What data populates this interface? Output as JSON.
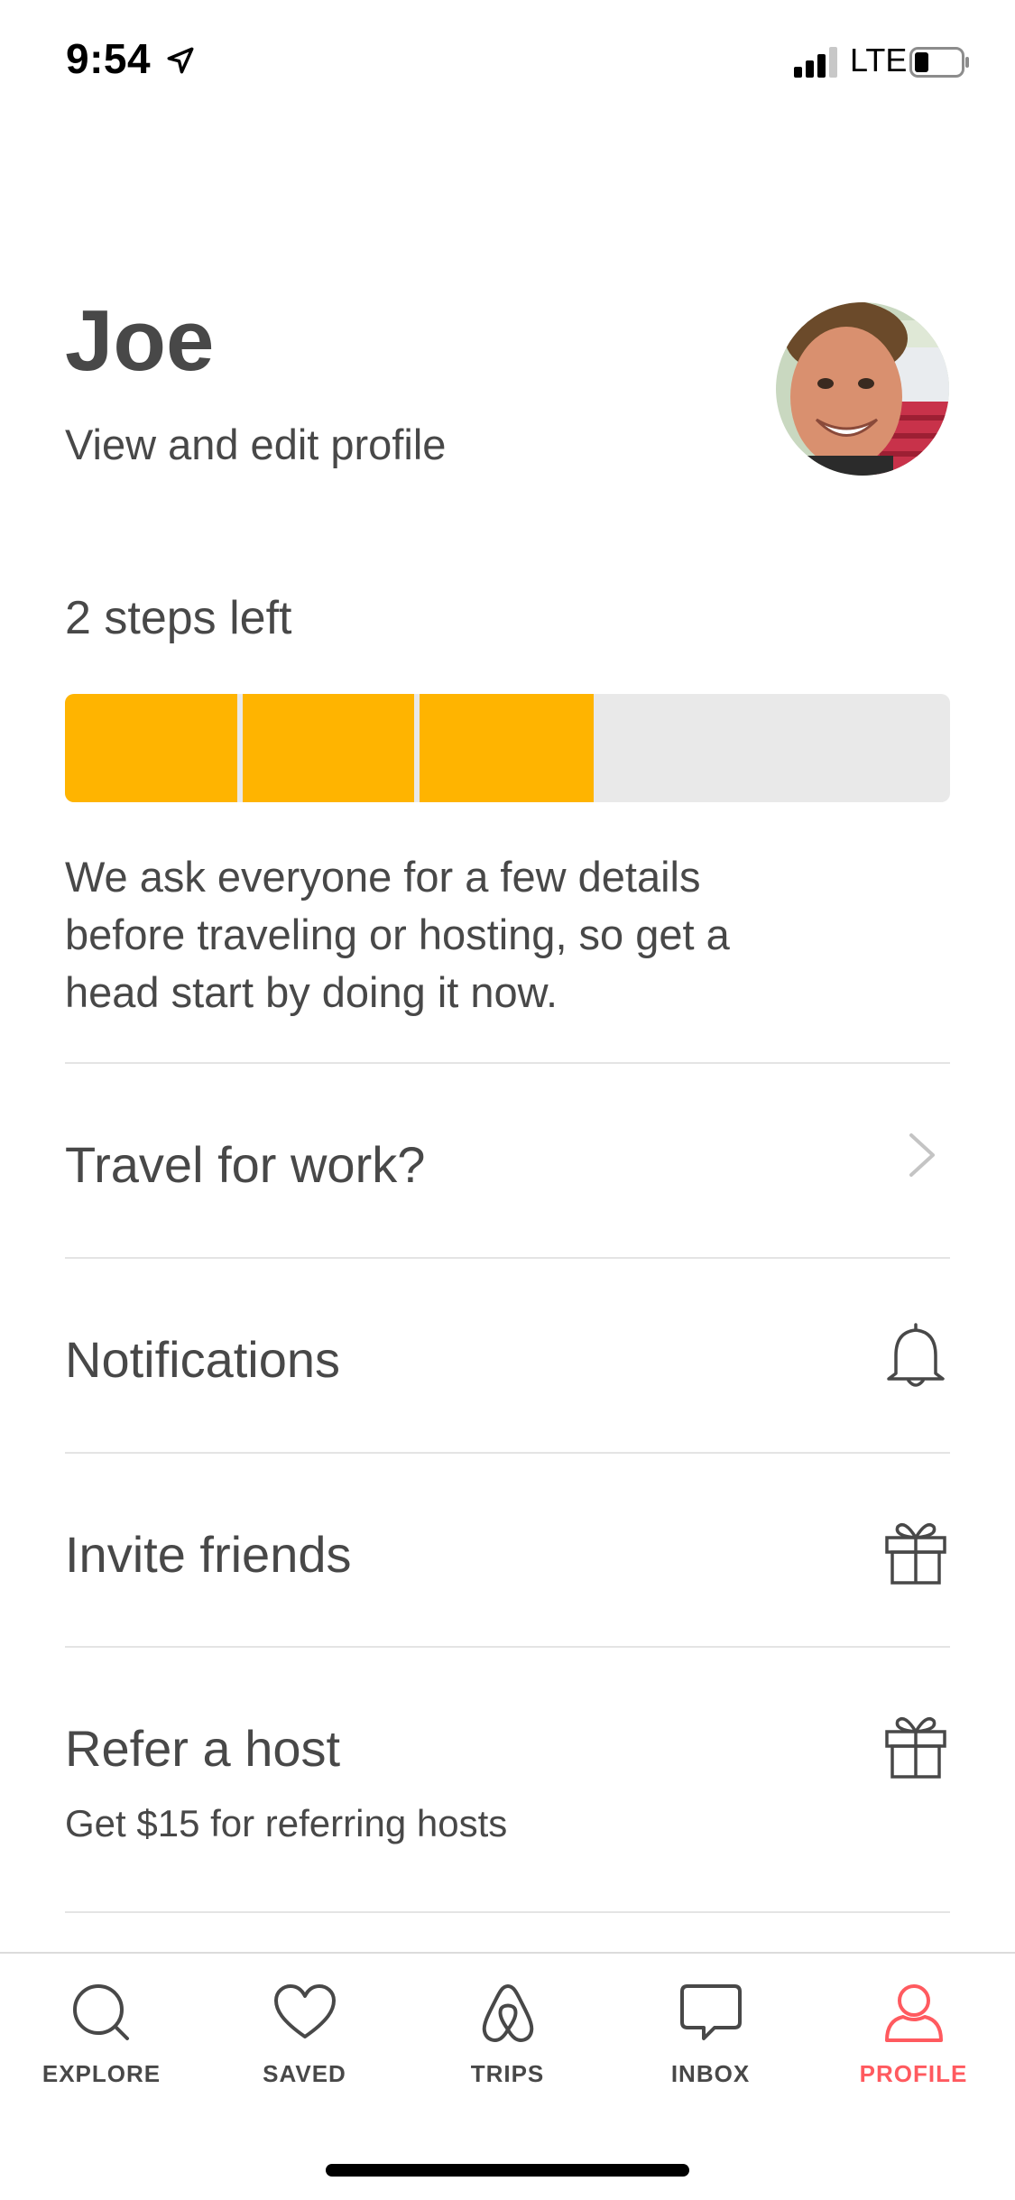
{
  "status_bar": {
    "time": "9:54",
    "network": "LTE"
  },
  "profile": {
    "name": "Joe",
    "edit_link": "View and edit profile"
  },
  "progress": {
    "steps_label": "2 steps left",
    "completed_segments": 3,
    "total_segments": 5,
    "fill_color": "#ffb400",
    "description": "We ask everyone for a few details before traveling or hosting, so get a head start by doing it now."
  },
  "menu": {
    "travel_for_work": {
      "label": "Travel for work?",
      "icon": "chevron-right-icon"
    },
    "notifications": {
      "label": "Notifications",
      "icon": "bell-icon"
    },
    "invite_friends": {
      "label": "Invite friends",
      "icon": "gift-icon"
    },
    "refer_host": {
      "label": "Refer a host",
      "sublabel": "Get $15 for referring hosts",
      "icon": "gift-icon"
    }
  },
  "tabs": [
    {
      "label": "EXPLORE",
      "icon": "search-icon"
    },
    {
      "label": "SAVED",
      "icon": "heart-icon"
    },
    {
      "label": "TRIPS",
      "icon": "airbnb-logo-icon"
    },
    {
      "label": "INBOX",
      "icon": "chat-icon"
    },
    {
      "label": "PROFILE",
      "icon": "person-icon",
      "active": true
    }
  ],
  "colors": {
    "accent": "#ff5a5f",
    "progress": "#ffb400",
    "text": "#484848"
  }
}
